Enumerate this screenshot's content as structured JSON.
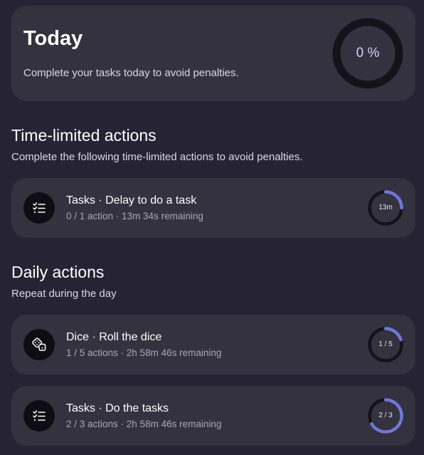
{
  "today": {
    "title": "Today",
    "subtitle": "Complete your tasks today to avoid penalties.",
    "progress_label": "0 %",
    "progress": 0
  },
  "time_limited": {
    "title": "Time-limited actions",
    "subtitle": "Complete the following time-limited actions to avoid penalties.",
    "items": [
      {
        "icon": "task-list-icon",
        "title": "Tasks · Delay to do a task",
        "meta": "0 / 1 action · 13m 34s remaining",
        "ring_label": "13m",
        "progress": 0.25
      }
    ]
  },
  "daily": {
    "title": "Daily actions",
    "subtitle": "Repeat during the day",
    "items": [
      {
        "icon": "dice-icon",
        "title": "Dice · Roll the dice",
        "meta": "1 / 5 actions · 2h 58m 46s remaining",
        "ring_label": "1 / 5",
        "progress": 0.2
      },
      {
        "icon": "task-list-icon",
        "title": "Tasks · Do the tasks",
        "meta": "2 / 3 actions · 2h 58m 46s remaining",
        "ring_label": "2 / 3",
        "progress": 0.6667
      }
    ]
  },
  "colors": {
    "background": "#262434",
    "card": "#34323f",
    "ring_track": "#141319",
    "ring_progress": "#6f78d6",
    "icon_bg": "#0e0d14"
  }
}
